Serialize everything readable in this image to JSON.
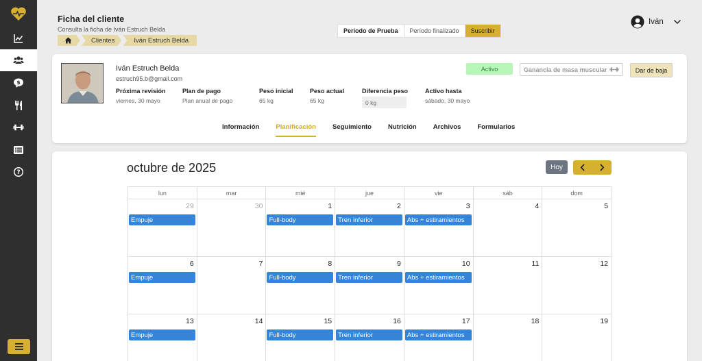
{
  "app": {
    "logo_icon": "heart-pulse-icon",
    "accent": "#d6b02e"
  },
  "sidebar": {
    "items": [
      {
        "icon": "chart-line-icon"
      },
      {
        "icon": "users-icon",
        "active": true
      },
      {
        "icon": "chat-dollar-icon"
      },
      {
        "icon": "utensils-icon"
      },
      {
        "icon": "dumbbell-icon"
      },
      {
        "icon": "list-icon"
      },
      {
        "icon": "help-circle-icon"
      }
    ],
    "menu_icon": "hamburger-icon"
  },
  "header": {
    "title": "Ficha del cliente",
    "subtitle": "Consulta la ficha de Iván Estruch Belda",
    "breadcrumb": {
      "home_icon": "home-icon",
      "item1": "Clientes",
      "item2": "Iván Estruch Belda"
    },
    "periods": {
      "p1": "Período de Prueba",
      "p2": "Período finalizado",
      "p3": "Suscribir"
    },
    "user": {
      "name": "Iván"
    }
  },
  "client": {
    "name": "Iván Estruch Belda",
    "email": "estruch95.b@gmail.com",
    "stats": {
      "next_review": {
        "label": "Próxima revisión",
        "value": "viernes, 30 mayo"
      },
      "plan": {
        "label": "Plan de pago",
        "value": "Plan anual de pago"
      },
      "start_weight": {
        "label": "Peso inicial",
        "value": "65 kg"
      },
      "current_weight": {
        "label": "Peso actual",
        "value": "65 kg"
      },
      "weight_diff": {
        "label": "Diferencia peso",
        "value": "0 kg"
      },
      "active_until": {
        "label": "Activo hasta",
        "value": "sábado, 30 mayo"
      }
    },
    "status": "Activo",
    "goal": "Ganancia de masa muscular",
    "drop_label": "Dar de baja"
  },
  "tabs": {
    "t1": "Información",
    "t2": "Planificación",
    "t3": "Seguimiento",
    "t4": "Nutrición",
    "t5": "Archivos",
    "t6": "Formularios"
  },
  "calendar": {
    "title": "octubre de 2025",
    "today_label": "Hoy",
    "weekdays": {
      "d1": "lun",
      "d2": "mar",
      "d3": "mié",
      "d4": "jue",
      "d5": "vie",
      "d6": "sáb",
      "d7": "dom"
    },
    "weeks": [
      {
        "days": [
          {
            "num": "29",
            "muted": true,
            "event": "Empuje"
          },
          {
            "num": "30",
            "muted": true,
            "event": ""
          },
          {
            "num": "1",
            "event": "Full-body"
          },
          {
            "num": "2",
            "event": "Tren inferior"
          },
          {
            "num": "3",
            "event": "Abs + estiramientos"
          },
          {
            "num": "4",
            "event": ""
          },
          {
            "num": "5",
            "event": ""
          }
        ]
      },
      {
        "days": [
          {
            "num": "6",
            "event": "Empuje"
          },
          {
            "num": "7",
            "event": ""
          },
          {
            "num": "8",
            "event": "Full-body"
          },
          {
            "num": "9",
            "event": "Tren inferior"
          },
          {
            "num": "10",
            "event": "Abs + estiramientos"
          },
          {
            "num": "11",
            "event": ""
          },
          {
            "num": "12",
            "event": ""
          }
        ]
      },
      {
        "days": [
          {
            "num": "13",
            "event": "Empuje"
          },
          {
            "num": "14",
            "event": ""
          },
          {
            "num": "15",
            "event": "Full-body"
          },
          {
            "num": "16",
            "event": "Tren inferior"
          },
          {
            "num": "17",
            "event": "Abs + estiramientos"
          },
          {
            "num": "18",
            "event": ""
          },
          {
            "num": "19",
            "event": ""
          }
        ]
      }
    ],
    "event_color": "#3584d8"
  }
}
